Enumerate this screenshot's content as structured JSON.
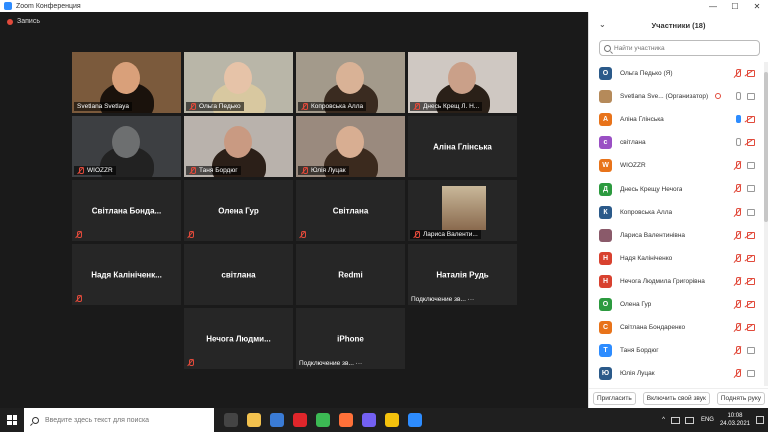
{
  "window": {
    "title": "Zoom Конференция",
    "controls": [
      "—",
      "☐",
      "✕"
    ]
  },
  "recording": {
    "label": "Запись"
  },
  "tiles": [
    {
      "name": "Svetlana Svetlaya",
      "mode": "video",
      "speaking": true,
      "muted": false
    },
    {
      "name": "Ольга Педько",
      "mode": "video",
      "speaking": false,
      "muted": true
    },
    {
      "name": "Копровська Алла",
      "mode": "video",
      "speaking": false,
      "muted": true
    },
    {
      "name": "Днесь Крещ Л. Н...",
      "mode": "video",
      "speaking": false,
      "muted": true
    },
    {
      "name": "WIOZZR",
      "mode": "video",
      "speaking": false,
      "muted": true
    },
    {
      "name": "Таня Бордюг",
      "mode": "video",
      "speaking": false,
      "muted": true
    },
    {
      "name": "Юлія Луцак",
      "mode": "video",
      "speaking": false,
      "muted": true
    },
    {
      "name": "Аліна Глінська",
      "mode": "name",
      "speaking": false,
      "muted": false
    },
    {
      "name": "Світлана Бонда...",
      "mode": "name",
      "speaking": false,
      "muted": true
    },
    {
      "name": "Олена Гур",
      "mode": "name",
      "speaking": false,
      "muted": true
    },
    {
      "name": "Світлана",
      "mode": "name",
      "speaking": false,
      "muted": true
    },
    {
      "name": "Лариса Валенти...",
      "mode": "photo",
      "speaking": false,
      "muted": true
    },
    {
      "name": "Надя Калініченк...",
      "mode": "name",
      "speaking": false,
      "muted": true
    },
    {
      "name": "світлана",
      "mode": "name",
      "speaking": false,
      "muted": false
    },
    {
      "name": "Redmi",
      "mode": "name",
      "speaking": false,
      "muted": false
    },
    {
      "name": "Наталія Рудь",
      "mode": "name",
      "speaking": false,
      "muted": false,
      "status": "Подключение зв... ···"
    },
    {
      "name": "Нечога Людми...",
      "mode": "name",
      "speaking": false,
      "muted": true
    },
    {
      "name": "iPhone",
      "mode": "name",
      "speaking": false,
      "muted": false,
      "status": "Подключение зв... ···"
    }
  ],
  "panel": {
    "title": "Участники (18)",
    "search_placeholder": "Найти участника",
    "participants": [
      {
        "initial": "О",
        "color": "#2b5a8a",
        "name": "Ольга Педько (Я)",
        "mic": "muted",
        "cam": "off"
      },
      {
        "initial": "",
        "color": "#b58a5a",
        "name": "Svetlana Sve... (Организатор)",
        "mic": "on",
        "cam": "on",
        "recording": true
      },
      {
        "initial": "А",
        "color": "#e8731a",
        "name": "Аліна Глінська",
        "mic": "talk",
        "cam": "off"
      },
      {
        "initial": "с",
        "color": "#9a4fc4",
        "name": "світлана",
        "mic": "on",
        "cam": "off"
      },
      {
        "initial": "W",
        "color": "#e8731a",
        "name": "WIOZZR",
        "mic": "muted",
        "cam": "on"
      },
      {
        "initial": "Д",
        "color": "#2c9a3f",
        "name": "Днесь Крещу Нечога",
        "mic": "muted",
        "cam": "on"
      },
      {
        "initial": "К",
        "color": "#2b5a8a",
        "name": "Копровська Алла",
        "mic": "muted",
        "cam": "on"
      },
      {
        "initial": "",
        "color": "#8a5a6a",
        "name": "Лариса Валентинівна",
        "mic": "muted",
        "cam": "off"
      },
      {
        "initial": "Н",
        "color": "#d8412f",
        "name": "Надя Калініченко",
        "mic": "muted",
        "cam": "off"
      },
      {
        "initial": "Н",
        "color": "#d8412f",
        "name": "Нечога Людмила Григорівна",
        "mic": "muted",
        "cam": "off"
      },
      {
        "initial": "О",
        "color": "#2c9a3f",
        "name": "Олена Гур",
        "mic": "muted",
        "cam": "off"
      },
      {
        "initial": "С",
        "color": "#e8731a",
        "name": "Світлана Бондаренко",
        "mic": "muted",
        "cam": "off"
      },
      {
        "initial": "Т",
        "color": "#2d8cff",
        "name": "Таня Бордюг",
        "mic": "muted",
        "cam": "on"
      },
      {
        "initial": "Ю",
        "color": "#2b5a8a",
        "name": "Юлія Луцак",
        "mic": "muted",
        "cam": "on"
      }
    ],
    "footer": {
      "invite": "Пригласить",
      "unmute": "Включить свой звук",
      "raise_hand": "Поднять руку"
    }
  },
  "taskbar": {
    "search_placeholder": "Введите здесь текст для поиска",
    "language": "ENG",
    "time": "10:08",
    "date": "24.03.2021",
    "apps": [
      {
        "name": "task-view",
        "color": "#444"
      },
      {
        "name": "file-explorer",
        "color": "#f2c14e"
      },
      {
        "name": "mail",
        "color": "#3a7bd5"
      },
      {
        "name": "opera",
        "color": "#e0262b"
      },
      {
        "name": "chrome",
        "color": "#3cba54"
      },
      {
        "name": "firefox",
        "color": "#ff7139"
      },
      {
        "name": "viber",
        "color": "#7360f2"
      },
      {
        "name": "chrome-alt",
        "color": "#f4c20d"
      },
      {
        "name": "zoom",
        "color": "#2d8cff"
      }
    ]
  }
}
